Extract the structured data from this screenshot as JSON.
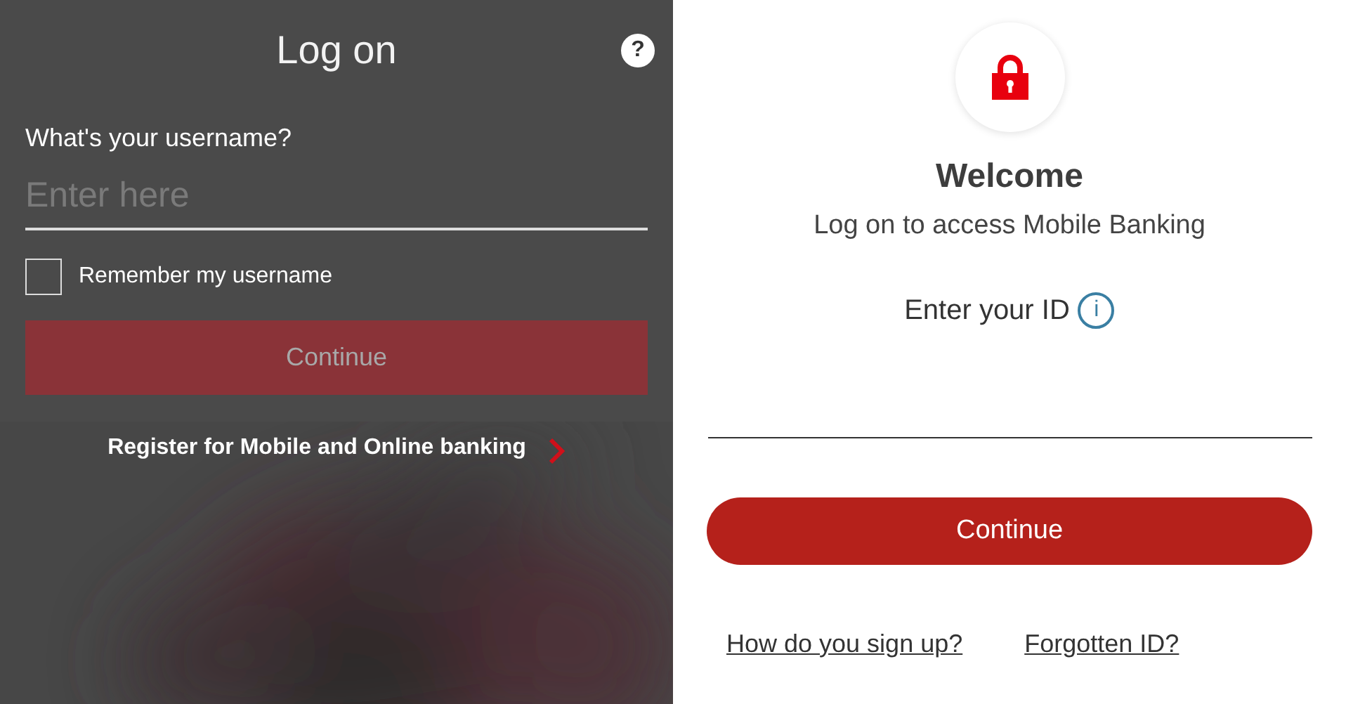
{
  "left_panel": {
    "title": "Log on",
    "help": "?",
    "username_label": "What's your username?",
    "username_field": {
      "placeholder": "Enter here"
    },
    "remember": {
      "label": "Remember my username",
      "checked": false
    },
    "continue_button": {
      "label": "Continue",
      "disabled": true
    },
    "register_link": "Register for Mobile and Online banking"
  },
  "right_panel": {
    "heading": "Welcome",
    "subtitle": "Log on to access Mobile Banking",
    "id_label": "Enter your ID",
    "info": "i",
    "continue_button": {
      "label": "Continue",
      "disabled": false
    },
    "links": [
      "How do you sign up?",
      "Forgotten ID?"
    ]
  }
}
